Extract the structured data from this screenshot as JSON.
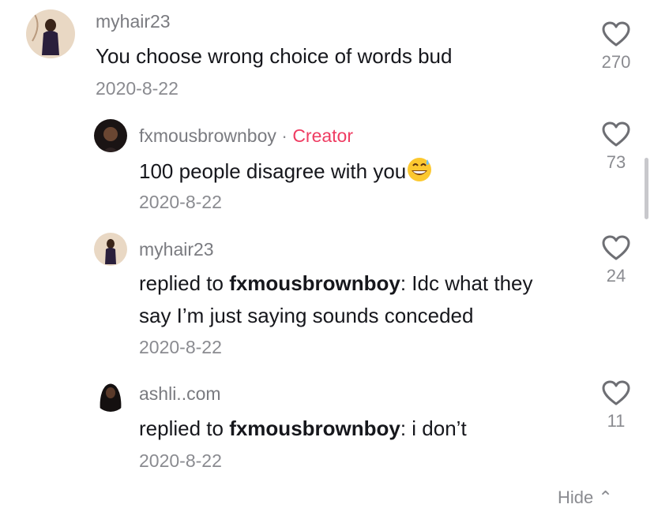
{
  "comments": [
    {
      "username": "myhair23",
      "text": "You choose wrong choice of words bud",
      "date": "2020-8-22",
      "likes": "270"
    },
    {
      "username": "fxmousbrownboy",
      "separator": "·",
      "badge": "Creator",
      "text": "100 people disagree with you",
      "emoji": "grinning-sweat-emoji",
      "date": "2020-8-22",
      "likes": "73"
    },
    {
      "username": "myhair23",
      "reply_prefix": "replied to ",
      "reply_to": "fxmousbrownboy",
      "text_line1": ": Idc what they",
      "text_line2": "say I’m just saying sounds conceded",
      "date": "2020-8-22",
      "likes": "24"
    },
    {
      "username": "ashli..com",
      "reply_prefix": "replied to ",
      "reply_to": "fxmousbrownboy",
      "text": ": i don’t",
      "date": "2020-8-22",
      "likes": "11"
    }
  ],
  "footer": {
    "hide_label": "Hide"
  },
  "colors": {
    "creator": "#ef3c62",
    "meta": "#8a8b90",
    "text": "#16171c"
  }
}
